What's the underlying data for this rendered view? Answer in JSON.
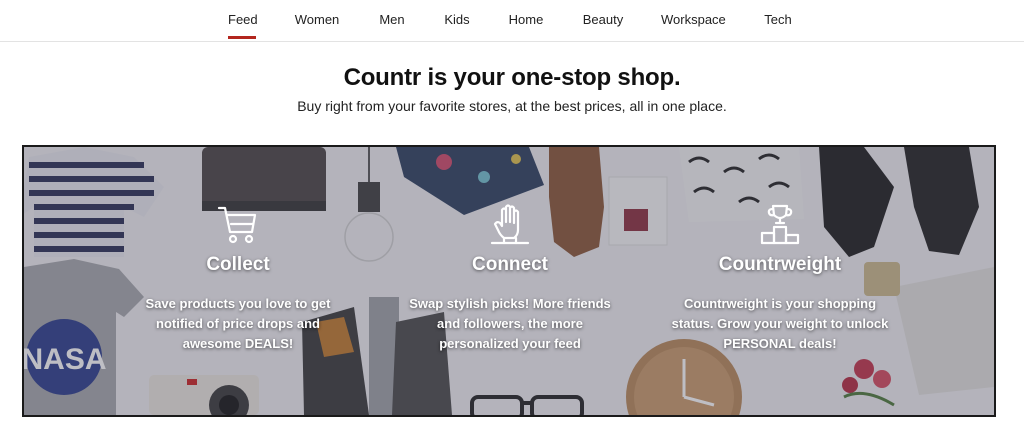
{
  "nav": {
    "items": [
      {
        "label": "Feed",
        "active": true
      },
      {
        "label": "Women"
      },
      {
        "label": "Men"
      },
      {
        "label": "Kids"
      },
      {
        "label": "Home"
      },
      {
        "label": "Beauty"
      },
      {
        "label": "Workspace"
      },
      {
        "label": "Tech"
      }
    ],
    "active_color": "#b3261e"
  },
  "hero": {
    "title": "Countr is your one-stop shop.",
    "subtitle": "Buy right from your favorite stores, at the best prices, all in one place."
  },
  "features": [
    {
      "icon": "shopping-cart-icon",
      "title": "Collect",
      "lines": [
        "Save products you love to get",
        "notified of price drops and",
        "awesome DEALS!"
      ]
    },
    {
      "icon": "hand-icon",
      "title": "Connect",
      "lines": [
        "Swap stylish picks! More friends",
        "and followers, the more",
        "personalized your feed"
      ]
    },
    {
      "icon": "trophy-podium-icon",
      "title": "Countrweight",
      "lines": [
        "Countrweight is your shopping",
        "status. Grow your weight to unlock",
        "PERSONAL deals!"
      ]
    }
  ],
  "banner_image_label": "NASA"
}
